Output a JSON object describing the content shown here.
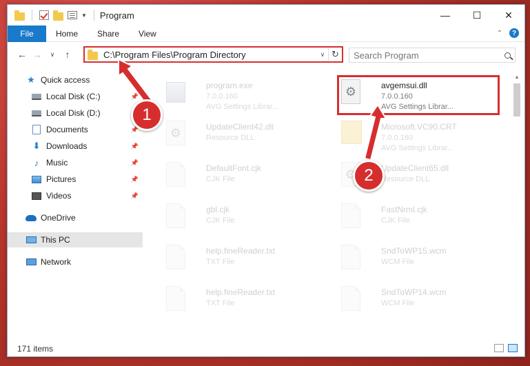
{
  "window": {
    "title": "Program",
    "controls": {
      "minimize": "—",
      "maximize": "☐",
      "close": "✕"
    }
  },
  "ribbon": {
    "tabs": [
      "File",
      "Home",
      "Share",
      "View"
    ]
  },
  "address": {
    "path": "C:\\Program Files\\Program Directory"
  },
  "search": {
    "placeholder": "Search Program"
  },
  "sidebar": {
    "items": [
      {
        "label": "Quick access",
        "icon": "star-icon"
      },
      {
        "label": "Local Disk (C:)",
        "icon": "disk-icon"
      },
      {
        "label": "Local Disk (D:)",
        "icon": "disk-icon"
      },
      {
        "label": "Documents",
        "icon": "documents-icon"
      },
      {
        "label": "Downloads",
        "icon": "download-icon"
      },
      {
        "label": "Music",
        "icon": "music-icon"
      },
      {
        "label": "Pictures",
        "icon": "pictures-icon"
      },
      {
        "label": "Videos",
        "icon": "videos-icon"
      },
      {
        "label": "OneDrive",
        "icon": "cloud-icon"
      },
      {
        "label": "This PC",
        "icon": "computer-icon"
      },
      {
        "label": "Network",
        "icon": "network-icon"
      }
    ]
  },
  "files": [
    {
      "name": "program.exe",
      "meta1": "7.0.0.160",
      "meta2": "AVG Settings Librar..."
    },
    {
      "name": "avgemsui.dll",
      "meta1": "7.0.0.160",
      "meta2": "AVG Settings Librar..."
    },
    {
      "name": "UpdateClient42.dll",
      "meta1": "Resource DLL",
      "meta2": ""
    },
    {
      "name": "Microsoft.VC90.CRT",
      "meta1": "7.0.0.160",
      "meta2": "AVG Settings Librar..."
    },
    {
      "name": "DefaultFont.cjk",
      "meta1": "CJK File",
      "meta2": ""
    },
    {
      "name": "UpdateClient65.dll",
      "meta1": "Resource DLL",
      "meta2": ""
    },
    {
      "name": "gbl.cjk",
      "meta1": "CJK File",
      "meta2": ""
    },
    {
      "name": "FastNrml.cjk",
      "meta1": "CJK File",
      "meta2": ""
    },
    {
      "name": "help.fineReader.txt",
      "meta1": "TXT File",
      "meta2": ""
    },
    {
      "name": "SndToWP15.wcm",
      "meta1": "WCM File",
      "meta2": ""
    },
    {
      "name": "help.fineReader.txt",
      "meta1": "TXT File",
      "meta2": ""
    },
    {
      "name": "SndToWP14.wcm",
      "meta1": "WCM File",
      "meta2": ""
    }
  ],
  "status": {
    "count": "171 items"
  },
  "annotations": {
    "badge1": "1",
    "badge2": "2",
    "color": "#d62e2e"
  }
}
